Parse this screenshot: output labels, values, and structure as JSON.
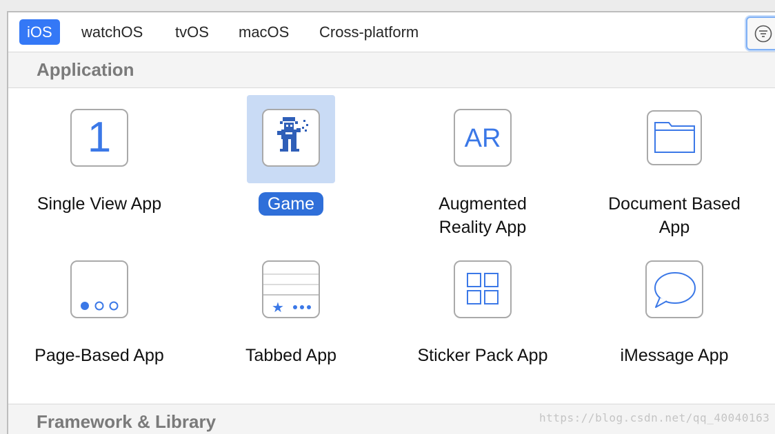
{
  "platform_tabs": [
    "iOS",
    "watchOS",
    "tvOS",
    "macOS",
    "Cross-platform"
  ],
  "active_tab": "iOS",
  "filter_button_icon": "filter-icon",
  "sections": {
    "application": "Application",
    "framework": "Framework & Library"
  },
  "templates": [
    {
      "label_lines": [
        "Single View App"
      ],
      "icon": "single-view-icon",
      "glyph": "1"
    },
    {
      "label_lines": [
        "Game"
      ],
      "icon": "game-icon",
      "selected": true
    },
    {
      "label_lines": [
        "Augmented",
        "Reality App"
      ],
      "icon": "ar-icon",
      "glyph": "AR"
    },
    {
      "label_lines": [
        "Document Based",
        "App"
      ],
      "icon": "folder-icon"
    },
    {
      "label_lines": [
        "Page-Based App"
      ],
      "icon": "page-dots-icon"
    },
    {
      "label_lines": [
        "Tabbed App"
      ],
      "icon": "tabbed-icon"
    },
    {
      "label_lines": [
        "Sticker Pack App"
      ],
      "icon": "sticker-grid-icon"
    },
    {
      "label_lines": [
        "iMessage App"
      ],
      "icon": "message-bubble-icon"
    }
  ],
  "watermark": "https://blog.csdn.net/qq_40040163",
  "colors": {
    "accent": "#3478f6",
    "selection": "#c9dbf5",
    "icon_blue": "#3b78e7"
  }
}
